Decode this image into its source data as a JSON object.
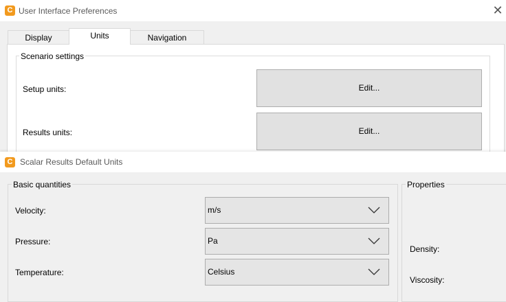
{
  "prefs_window": {
    "title": "User Interface Preferences",
    "background_text": "",
    "tabs": [
      {
        "label": "Display"
      },
      {
        "label": "Units"
      },
      {
        "label": "Navigation"
      }
    ],
    "active_tab": "Units",
    "scenario_group": {
      "legend": "Scenario settings",
      "rows": [
        {
          "label": "Setup units:",
          "button": "Edit..."
        },
        {
          "label": "Results units:",
          "button": "Edit..."
        }
      ]
    }
  },
  "scalar_window": {
    "title": "Scalar Results Default Units",
    "basic_group": {
      "legend": "Basic quantities",
      "rows": [
        {
          "label": "Velocity:",
          "value": "m/s"
        },
        {
          "label": "Pressure:",
          "value": "Pa"
        },
        {
          "label": "Temperature:",
          "value": "Celsius"
        }
      ]
    },
    "properties_group": {
      "legend": "Properties",
      "rows": [
        {
          "label": "Density:"
        },
        {
          "label": "Viscosity:"
        }
      ]
    }
  },
  "colors": {
    "app_icon": "#f29a1e",
    "button_face": "#e1e1e1",
    "combo_face": "#e5e5e5",
    "border": "#adadad"
  },
  "icons": {
    "app": "app-logo-icon",
    "close": "close-icon",
    "dropdown": "chevron-down-icon"
  }
}
